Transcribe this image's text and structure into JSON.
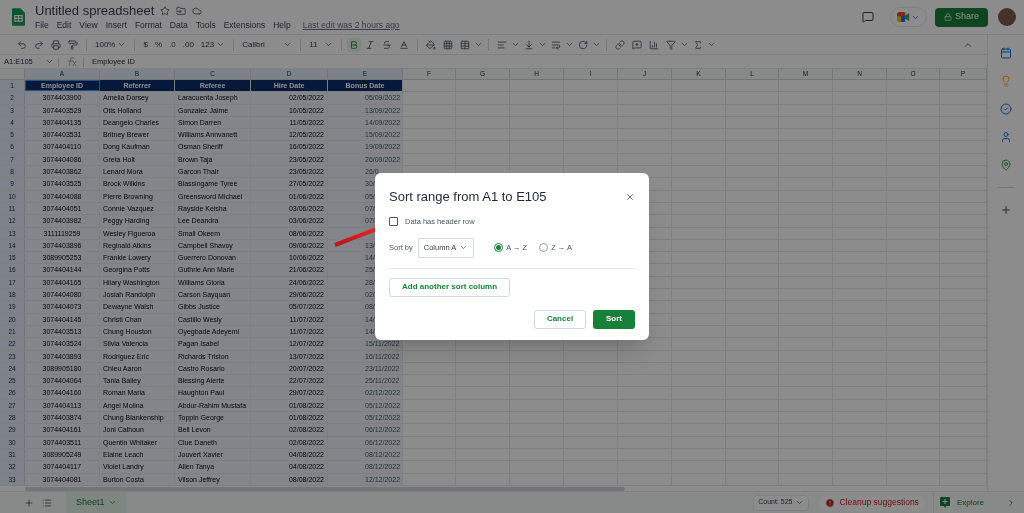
{
  "app": {
    "title": "Untitled spreadsheet",
    "menu": [
      "File",
      "Edit",
      "View",
      "Insert",
      "Format",
      "Data",
      "Tools",
      "Extensions",
      "Help"
    ],
    "last_edit": "Last edit was 2 hours ago",
    "share": "Share"
  },
  "toolbar": {
    "zoom": "100%",
    "currency": "$",
    "percent": "%",
    "decrease_decimals": ".0",
    "increase_decimals": ".00",
    "more_formats": "123",
    "font": "Calibri",
    "font_size": "11",
    "bold_on": true
  },
  "formula_bar": {
    "name_box": "A1:E105",
    "value": "Employee ID"
  },
  "columns": [
    "A",
    "B",
    "C",
    "D",
    "E",
    "F",
    "G",
    "H",
    "I",
    "J",
    "K",
    "L",
    "M",
    "N",
    "O",
    "P"
  ],
  "rows": [
    {
      "number": "1",
      "kind": "header",
      "cells": [
        "Employee ID",
        "Referrer",
        "Referee",
        "Hire Date",
        "Bonus Date"
      ]
    },
    {
      "number": "2",
      "kind": "data",
      "cells": [
        "3074403900",
        "Amelia Dorsey",
        "Laracuenta Joseph",
        "02/05/2022",
        "05/09/2022"
      ]
    },
    {
      "number": "3",
      "kind": "data",
      "cells": [
        "3074403529",
        "Otis Holland",
        "Gonzalez Jaime",
        "10/05/2022",
        "13/09/2022"
      ]
    },
    {
      "number": "4",
      "kind": "data",
      "cells": [
        "3074404135",
        "Deangelo Charles",
        "Simon Darren",
        "11/05/2022",
        "14/09/2022"
      ]
    },
    {
      "number": "5",
      "kind": "data",
      "cells": [
        "3074403531",
        "Britney Brewer",
        "Williams Annvanett",
        "12/05/2022",
        "15/09/2022"
      ]
    },
    {
      "number": "6",
      "kind": "data",
      "cells": [
        "3074404110",
        "Dong Kaufman",
        "Osman Sheriff",
        "16/05/2022",
        "19/09/2022"
      ]
    },
    {
      "number": "7",
      "kind": "data",
      "cells": [
        "3074404086",
        "Greta Holt",
        "Brown Taja",
        "23/05/2022",
        "26/09/2022"
      ]
    },
    {
      "number": "8",
      "kind": "data",
      "cells": [
        "3074403862",
        "Lenard Mora",
        "Garcon Thair",
        "23/05/2022",
        "26/0"
      ]
    },
    {
      "number": "9",
      "kind": "data",
      "cells": [
        "3074403525",
        "Brock Wilkins",
        "Blassingame Tyree",
        "27/05/2022",
        "30/"
      ]
    },
    {
      "number": "10",
      "kind": "data",
      "cells": [
        "3074404088",
        "Pierre Browning",
        "Greensword Michael",
        "01/06/2022",
        "05/"
      ]
    },
    {
      "number": "11",
      "kind": "data",
      "cells": [
        "3074404051",
        "Connie Vazquez",
        "Rayside Keisha",
        "03/06/2022",
        "07/"
      ]
    },
    {
      "number": "12",
      "kind": "data",
      "cells": [
        "3074403982",
        "Peggy Harding",
        "Lee Deandra",
        "03/06/2022",
        "07/"
      ]
    },
    {
      "number": "13",
      "kind": "data",
      "cells": [
        "3111119259",
        "Wesley Figueroa",
        "Small Okeem",
        "08/06/2022"
      ]
    },
    {
      "number": "14",
      "kind": "data",
      "cells": [
        "3074403896",
        "Reginald Atkins",
        "Campbell Shavoy",
        "09/06/2022",
        "13/"
      ]
    },
    {
      "number": "15",
      "kind": "data",
      "cells": [
        "3089905253",
        "Frankie Lowery",
        "Guerrero Donovan",
        "10/06/2022",
        "14/"
      ]
    },
    {
      "number": "16",
      "kind": "data",
      "cells": [
        "3074404144",
        "Georgina Potts",
        "Guthrie Ann Marie",
        "21/06/2022",
        "25/"
      ]
    },
    {
      "number": "17",
      "kind": "data",
      "cells": [
        "3074404165",
        "Hilary Washington",
        "Williams Gloria",
        "24/06/2022",
        "28/"
      ]
    },
    {
      "number": "18",
      "kind": "data",
      "cells": [
        "3074404080",
        "Josiah Randolph",
        "Carson Sayquan",
        "29/06/2022",
        "02/"
      ]
    },
    {
      "number": "19",
      "kind": "data",
      "cells": [
        "3074404073",
        "Dewayne Walsh",
        "Gibbs Justice",
        "05/07/2022",
        "08/"
      ]
    },
    {
      "number": "20",
      "kind": "data",
      "cells": [
        "3074404145",
        "Christi Chan",
        "Castillo Wesly",
        "11/07/2022",
        "14/"
      ]
    },
    {
      "number": "21",
      "kind": "data",
      "cells": [
        "3074403513",
        "Chung Houston",
        "Oyegbade Adeyemi",
        "11/07/2022",
        "14/"
      ]
    },
    {
      "number": "22",
      "kind": "data",
      "cells": [
        "3074403524",
        "Silvia Valencia",
        "Pagan Isabel",
        "12/07/2022",
        "15/11/2022"
      ]
    },
    {
      "number": "23",
      "kind": "data",
      "cells": [
        "3074403893",
        "Rodriguez Eric",
        "Richards Triston",
        "13/07/2022",
        "16/11/2022"
      ]
    },
    {
      "number": "24",
      "kind": "data",
      "cells": [
        "3089905180",
        "Chieu Aaron",
        "Castro Rosario",
        "20/07/2022",
        "23/11/2022"
      ]
    },
    {
      "number": "25",
      "kind": "data",
      "cells": [
        "3074404064",
        "Tania Bailey",
        "Blessing Alerte",
        "22/07/2022",
        "25/11/2022"
      ]
    },
    {
      "number": "26",
      "kind": "data",
      "cells": [
        "3074404160",
        "Roman Maria",
        "Haughton Paul",
        "29/07/2022",
        "02/12/2022"
      ]
    },
    {
      "number": "27",
      "kind": "data",
      "cells": [
        "3074404113",
        "Angel Molina",
        "Abdur-Rahim Mustafa",
        "01/08/2022",
        "05/12/2022"
      ]
    },
    {
      "number": "28",
      "kind": "data",
      "cells": [
        "3074403874",
        "Chung Blankenship",
        "Toppin George",
        "01/08/2022",
        "05/12/2022"
      ]
    },
    {
      "number": "29",
      "kind": "data",
      "cells": [
        "3074404161",
        "Joni Calhoun",
        "Bell Levon",
        "02/08/2022",
        "06/12/2022"
      ]
    },
    {
      "number": "30",
      "kind": "data",
      "cells": [
        "3074403511",
        "Quentin Whitaker",
        "Clue Daneth",
        "02/08/2022",
        "06/12/2022"
      ]
    },
    {
      "number": "31",
      "kind": "data",
      "cells": [
        "3089905249",
        "Elaine Leach",
        "Jouvert Xavier",
        "04/08/2022",
        "08/12/2022"
      ]
    },
    {
      "number": "32",
      "kind": "data",
      "cells": [
        "3074404117",
        "Violet Landry",
        "Allen Tanya",
        "04/08/2022",
        "08/12/2022"
      ]
    },
    {
      "number": "33",
      "kind": "data",
      "cells": [
        "3074404081",
        "Burton Costa",
        "Vilson Jeffrey",
        "08/08/2022",
        "12/12/2022"
      ]
    }
  ],
  "sheet_tabs": [
    {
      "label": "Sheet1",
      "selected": true
    }
  ],
  "status": {
    "count": "Count: 525",
    "cleanup": "Cleanup suggestions",
    "explore": "Explore"
  },
  "dialog": {
    "title": "Sort range from A1 to E105",
    "header_row": {
      "label": "Data has header row",
      "checked": false
    },
    "sort_by_label": "Sort by",
    "column": "Column A",
    "orders": [
      {
        "label": "A → Z",
        "selected": true
      },
      {
        "label": "Z → A",
        "selected": false
      }
    ],
    "add_column": "Add another sort column",
    "cancel": "Cancel",
    "sort": "Sort"
  }
}
